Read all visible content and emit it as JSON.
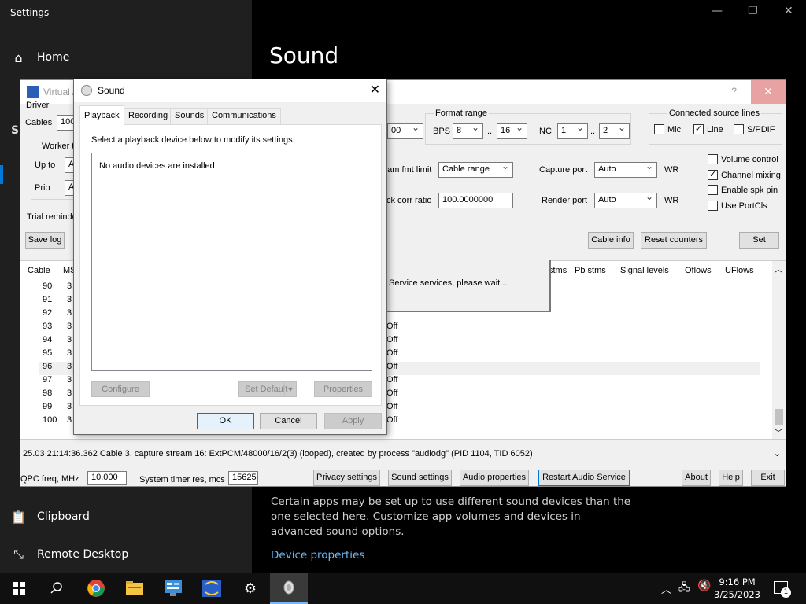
{
  "settings": {
    "window_title": "Settings",
    "home_label": "Home",
    "clipboard_label": "Clipboard",
    "remote_desktop_label": "Remote Desktop",
    "page_heading": "Sound",
    "description": "Certain apps may be set up to use different sound devices than the one selected here. Customize app volumes and devices in advanced sound options.",
    "device_properties_link": "Device properties",
    "sidebar_fragment_s": "S"
  },
  "vac": {
    "title": "Virtual A",
    "help": "?",
    "driver_label": "Driver",
    "cables_label": "Cables",
    "cables_value": "100",
    "worker_label": "Worker t",
    "up_to_label": "Up to",
    "up_to_value": "A",
    "prio_label": "Prio",
    "prio_value": "A",
    "trial_label": "Trial reminde",
    "save_log": "Save log",
    "sr_value": "00",
    "format_range_label": "Format range",
    "bps_label": "BPS",
    "bps_min": "8",
    "bps_max": "16",
    "range_sep": "..",
    "nc_label": "NC",
    "nc_min": "1",
    "nc_max": "2",
    "connected_label": "Connected source lines",
    "mic_label": "Mic",
    "line_label": "Line",
    "spdif_label": "S/PDIF",
    "stream_fmt_label": "eam fmt limit",
    "stream_fmt_value": "Cable range",
    "clock_corr_label": "ck corr ratio",
    "clock_corr_value": "100.0000000",
    "capture_port_label": "Capture port",
    "capture_port_value": "Auto",
    "render_port_label": "Render port",
    "render_port_value": "Auto",
    "wr_label": "WR",
    "volume_control": "Volume control",
    "channel_mixing": "Channel mixing",
    "enable_spk_pin": "Enable spk pin",
    "use_portcls": "Use PortCls",
    "cable_info": "Cable info",
    "reset_counters": "Reset counters",
    "set": "Set",
    "columns": {
      "cable": "Cable",
      "ms": "MS",
      "pb_stms_partial": "stms",
      "pb_stms": "Pb stms",
      "signal_levels": "Signal levels",
      "oflows": "Oflows",
      "uflows": "UFlows"
    },
    "rows": [
      {
        "n": "90",
        "m": "3",
        "o": ""
      },
      {
        "n": "91",
        "m": "3",
        "o": ""
      },
      {
        "n": "92",
        "m": "3",
        "o": ""
      },
      {
        "n": "93",
        "m": "3",
        "o": "Off"
      },
      {
        "n": "94",
        "m": "3",
        "o": "Off"
      },
      {
        "n": "95",
        "m": "3",
        "o": "Off"
      },
      {
        "n": "96",
        "m": "3",
        "o": "Off"
      },
      {
        "n": "97",
        "m": "3",
        "o": "Off"
      },
      {
        "n": "98",
        "m": "3",
        "o": "Off"
      },
      {
        "n": "99",
        "m": "3",
        "o": "Off"
      },
      {
        "n": "100",
        "m": "3",
        "o": "Off"
      }
    ],
    "wait_text": "Service services, please wait...",
    "status_line": "25.03   21:14:36.362  Cable 3, capture stream 16: ExtPCM/48000/16/2(3) (looped), created by process \"audiodg\" (PID 1104, TID 6052)",
    "qpc_label": "QPC freq, MHz",
    "qpc_value": "10.000",
    "timer_label": "System timer res, mcs",
    "timer_value": "15625",
    "privacy_settings": "Privacy settings",
    "sound_settings": "Sound settings",
    "audio_properties": "Audio properties",
    "restart_audio": "Restart Audio Service",
    "about": "About",
    "help_btn": "Help",
    "exit": "Exit"
  },
  "sound_dialog": {
    "title": "Sound",
    "tabs": [
      "Playback",
      "Recording",
      "Sounds",
      "Communications"
    ],
    "instruction": "Select a playback device below to modify its settings:",
    "empty_text": "No audio devices are installed",
    "configure": "Configure",
    "set_default": "Set Default",
    "properties": "Properties",
    "ok": "OK",
    "cancel": "Cancel",
    "apply": "Apply"
  },
  "taskbar": {
    "time": "9:16 PM",
    "date": "3/25/2023",
    "notification_count": "1"
  },
  "colors": {
    "accent_blue": "#0078d7",
    "link_blue": "#6ab8f7",
    "close_red": "#e8a2a2"
  }
}
